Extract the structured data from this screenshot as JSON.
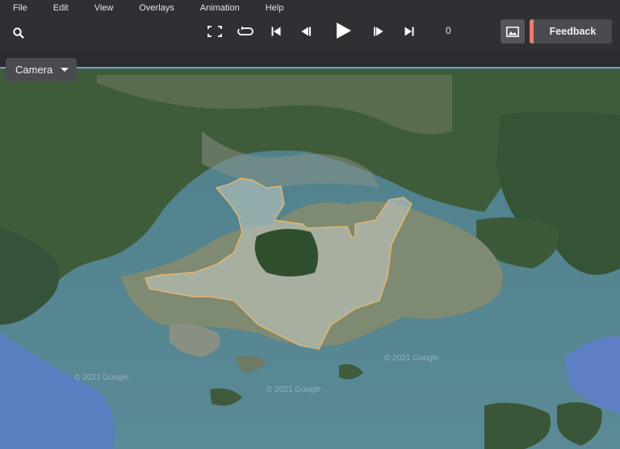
{
  "menu": [
    "File",
    "Edit",
    "View",
    "Overlays",
    "Animation",
    "Help"
  ],
  "toolbar": {
    "search_icon": "search-icon",
    "frame_number": "0",
    "feedback_label": "Feedback",
    "accent_color": "#f07a68"
  },
  "camera": {
    "label": "Camera"
  },
  "map": {
    "watermarks": [
      "© 2021 Google",
      "© 2021 Google",
      "© 2021 Google"
    ],
    "boundary_color": "#e7b56a",
    "water_color": "#3e6f84",
    "land_color": "#3f5d3c"
  }
}
